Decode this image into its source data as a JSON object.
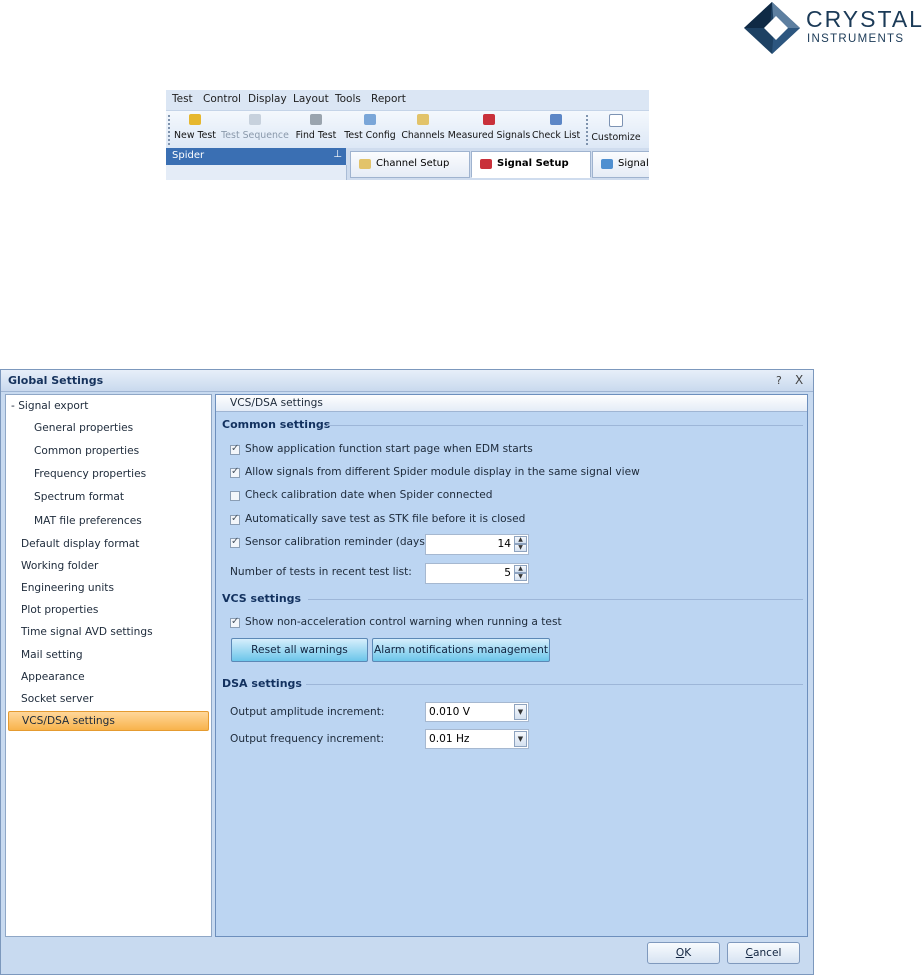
{
  "logo": {
    "line1": "CRYSTAL",
    "line2": "INSTRUMENTS"
  },
  "toolbar": {
    "menu": [
      "Test",
      "Control",
      "Display",
      "Layout",
      "Tools",
      "Report"
    ],
    "buttons": [
      "New Test",
      "Test Sequence",
      "Find Test",
      "Test Config",
      "Channels",
      "Measured Signals",
      "Check List",
      "Customize"
    ],
    "panel_title": "Spider",
    "panel_pin": "ᵖ",
    "tabs": [
      "Channel Setup",
      "Signal Setup",
      "Signal I"
    ]
  },
  "dialog": {
    "title": "Global Settings",
    "help": "?",
    "close": "X",
    "tree": [
      "- Signal export",
      "General properties",
      "Common properties",
      "Frequency properties",
      "Spectrum format",
      "MAT file preferences",
      "Default display format",
      "Working folder",
      "Engineering units",
      "Plot properties",
      "Time signal AVD settings",
      "Mail setting",
      "Appearance",
      "Socket server",
      "VCS/DSA settings"
    ],
    "selected_index": 14,
    "pane_title": "VCS/DSA settings",
    "common": {
      "heading": "Common settings",
      "checks": [
        {
          "label": "Show application function start page when EDM starts",
          "checked": true
        },
        {
          "label": "Allow signals from different Spider module display in the same signal view",
          "checked": true
        },
        {
          "label": "Check calibration date when Spider connected",
          "checked": false
        },
        {
          "label": "Automatically save test as STK file before it is closed",
          "checked": true
        },
        {
          "label": "Sensor calibration reminder (days)",
          "checked": true
        }
      ],
      "reminder_days": "14",
      "recent_label": "Number of tests in recent test list:",
      "recent_count": "5"
    },
    "vcs": {
      "heading": "VCS settings",
      "check": {
        "label": "Show non-acceleration control warning when running a test",
        "checked": true
      },
      "reset_button": "Reset all warnings",
      "alarm_button": "Alarm notifications management"
    },
    "dsa": {
      "heading": "DSA settings",
      "amp_label": "Output amplitude increment:",
      "amp_value": "0.010 V",
      "freq_label": "Output frequency increment:",
      "freq_value": "0.01 Hz"
    },
    "ok_hotkey": "O",
    "ok_rest": "K",
    "cancel_hotkey": "C",
    "cancel_rest": "ancel"
  },
  "colors": {
    "selected": "#f8b34c",
    "accent_button": "#6cc6ea",
    "title_text": "#15325c"
  }
}
